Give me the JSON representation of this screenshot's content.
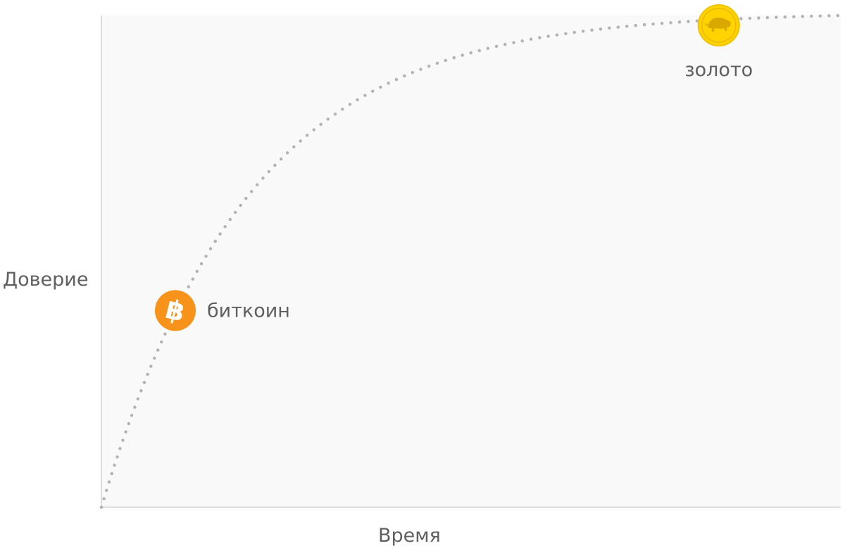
{
  "chart_data": {
    "type": "line",
    "title": "",
    "xlabel": "Время",
    "ylabel": "Доверие",
    "curve": "saturating",
    "line_style": "dotted",
    "line_color": "#b3b3b3",
    "plot_background": "#f9f9f9",
    "grid": false,
    "legend": "none",
    "points": [
      {
        "name": "биткоин",
        "icon": "bitcoin-icon",
        "color": "#f7931a",
        "x": 0.1,
        "y": 0.4
      },
      {
        "name": "золото",
        "icon": "gold-coin-bison-icon",
        "color": "#ffd200",
        "x": 0.835,
        "y": 0.98
      }
    ]
  }
}
